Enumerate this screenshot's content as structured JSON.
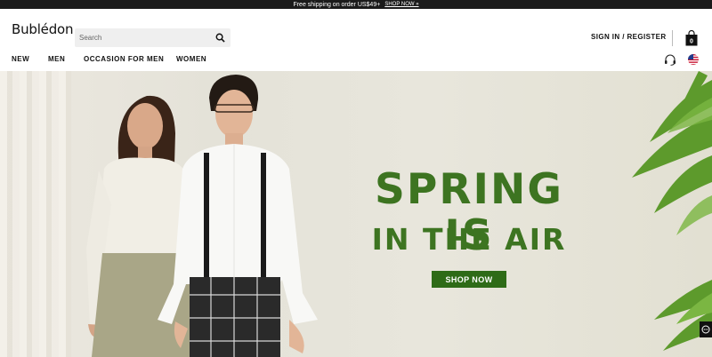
{
  "announcement": {
    "text": "Free shipping on order US$49+",
    "link": "SHOP NOW »"
  },
  "header": {
    "logo": "Bublédon",
    "search_placeholder": "Search",
    "sign_in": "SIGN IN / REGISTER",
    "bag_count": "0"
  },
  "nav": {
    "items": [
      "NEW",
      "MEN",
      "OCCASION FOR MEN",
      "WOMEN"
    ]
  },
  "hero": {
    "headline_1": "SPRING IS",
    "headline_2": "IN THE AIR",
    "cta": "SHOP NOW",
    "accent": "#3d7421",
    "button_color": "#2e6b17"
  },
  "icons": [
    "search-icon",
    "shopping-bag-icon",
    "headset-support-icon",
    "us-flag-icon",
    "chat-icon"
  ]
}
